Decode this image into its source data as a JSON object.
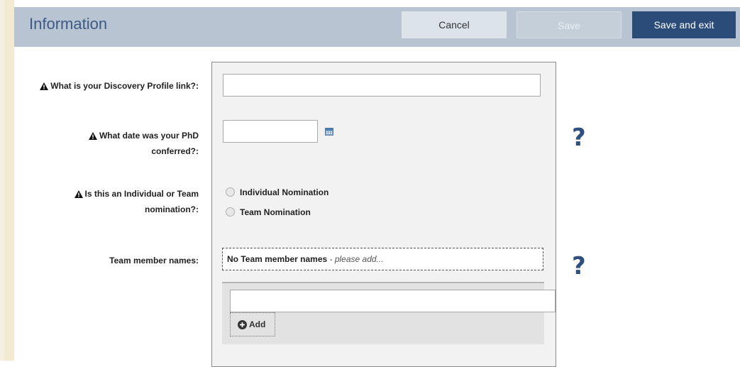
{
  "header": {
    "title": "Information",
    "cancel_label": "Cancel",
    "save_label": "Save",
    "save_exit_label": "Save and exit"
  },
  "fields": {
    "discovery_label": "What is your Discovery Profile link?:",
    "discovery_value": "",
    "phd_label_line1": "What date was your PhD",
    "phd_label_line2": "conferred?:",
    "phd_value": "",
    "nomination_label_line1": "Is this an Individual or Team",
    "nomination_label_line2": "nomination?:",
    "nomination_options": [
      "Individual Nomination",
      "Team Nomination"
    ],
    "team_label": "Team member names:",
    "team_empty_bold": "No Team member names",
    "team_empty_hint": " - please add...",
    "team_input_value": "",
    "add_label": "Add"
  },
  "help_glyph": "?",
  "icons": {
    "warning": "warning-triangle-icon",
    "calendar": "calendar-icon",
    "help": "help-icon",
    "add": "plus-circle-icon"
  },
  "colors": {
    "header_bg": "#b8c4d2",
    "title": "#3d5a84",
    "primary_button": "#2b4c79",
    "help": "#2f4f7e"
  }
}
